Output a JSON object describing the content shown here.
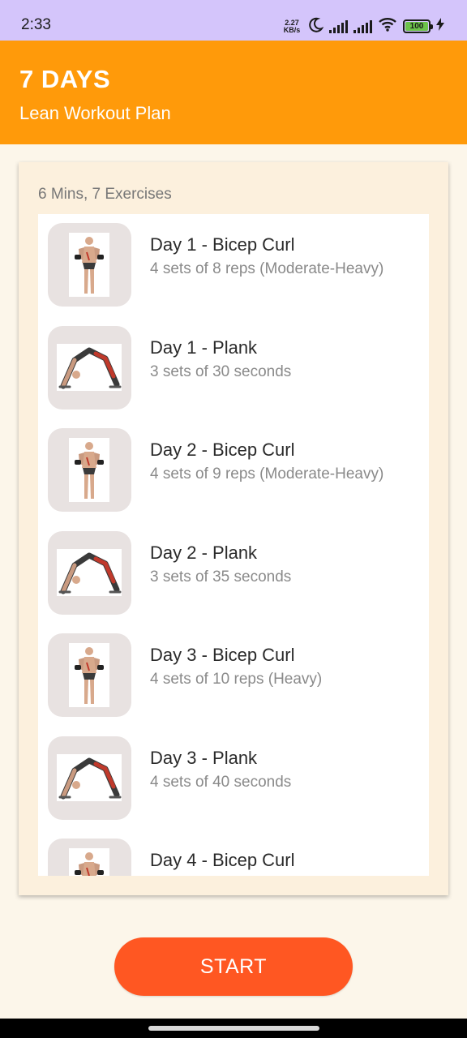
{
  "status_bar": {
    "time": "2:33",
    "net_speed_value": "2.27",
    "net_speed_unit": "KB/s",
    "battery_level": "100",
    "icons": [
      "moon-icon",
      "signal-icon",
      "signal-icon",
      "wifi-icon",
      "battery-icon",
      "charging-icon"
    ]
  },
  "header": {
    "title": "7 DAYS",
    "subtitle": "Lean Workout Plan"
  },
  "card": {
    "summary": "6 Mins, 7 Exercises"
  },
  "exercises": [
    {
      "title": "Day 1 - Bicep Curl",
      "detail": "4 sets of 8 reps (Moderate-Heavy)",
      "image": "bicep-curl"
    },
    {
      "title": "Day 1 - Plank",
      "detail": "3 sets of 30 seconds",
      "image": "plank"
    },
    {
      "title": "Day 2 - Bicep Curl",
      "detail": "4 sets of 9 reps (Moderate-Heavy)",
      "image": "bicep-curl"
    },
    {
      "title": "Day 2 - Plank",
      "detail": "3 sets of 35 seconds",
      "image": "plank"
    },
    {
      "title": "Day 3 - Bicep Curl",
      "detail": "4 sets of 10 reps (Heavy)",
      "image": "bicep-curl"
    },
    {
      "title": "Day 3 - Plank",
      "detail": "4 sets of 40 seconds",
      "image": "plank"
    },
    {
      "title": "Day 4 - Bicep Curl",
      "detail": "",
      "image": "bicep-curl"
    }
  ],
  "start_button": {
    "label": "START"
  },
  "colors": {
    "status_bar": "#d4c5fb",
    "header": "#ff9a0a",
    "background": "#fcf6ea",
    "card": "#fcf0dd",
    "start_button": "#ff5722"
  }
}
